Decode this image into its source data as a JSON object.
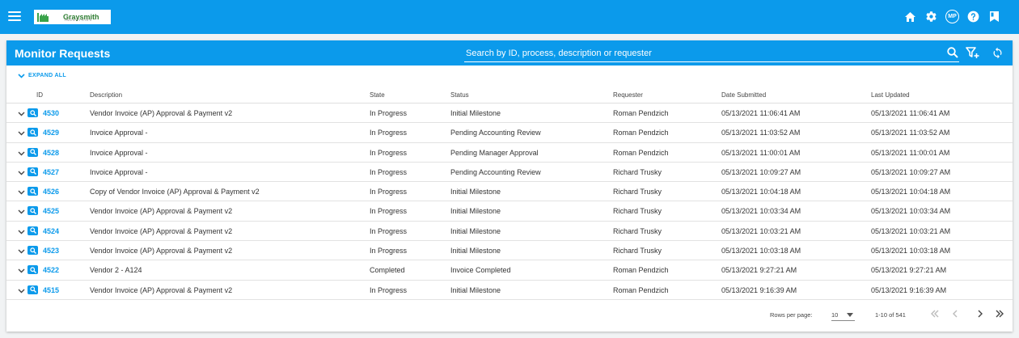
{
  "app": {
    "logo_name": "Graysmith",
    "logo_sub": "INDUSTRIES",
    "avatar_initials": "MP"
  },
  "card": {
    "title": "Monitor Requests",
    "search_placeholder": "Search by ID, process, description or requester",
    "expand_all_label": "EXPAND ALL"
  },
  "columns": {
    "id": "ID",
    "description": "Description",
    "state": "State",
    "status": "Status",
    "requester": "Requester",
    "date_submitted": "Date Submitted",
    "last_updated": "Last Updated"
  },
  "rows": [
    {
      "id": "4530",
      "description": "Vendor Invoice (AP) Approval & Payment v2",
      "state": "In Progress",
      "status": "Initial Milestone",
      "requester": "Roman Pendzich",
      "date_submitted": "05/13/2021 11:06:41 AM",
      "last_updated": "05/13/2021 11:06:41 AM"
    },
    {
      "id": "4529",
      "description": "Invoice Approval -",
      "state": "In Progress",
      "status": "Pending Accounting Review",
      "requester": "Roman Pendzich",
      "date_submitted": "05/13/2021 11:03:52 AM",
      "last_updated": "05/13/2021 11:03:52 AM"
    },
    {
      "id": "4528",
      "description": "Invoice Approval -",
      "state": "In Progress",
      "status": "Pending Manager Approval",
      "requester": "Roman Pendzich",
      "date_submitted": "05/13/2021 11:00:01 AM",
      "last_updated": "05/13/2021 11:00:01 AM"
    },
    {
      "id": "4527",
      "description": "Invoice Approval -",
      "state": "In Progress",
      "status": "Pending Accounting Review",
      "requester": "Richard Trusky",
      "date_submitted": "05/13/2021 10:09:27 AM",
      "last_updated": "05/13/2021 10:09:27 AM"
    },
    {
      "id": "4526",
      "description": "Copy of Vendor Invoice (AP) Approval & Payment v2",
      "state": "In Progress",
      "status": "Initial Milestone",
      "requester": "Richard Trusky",
      "date_submitted": "05/13/2021 10:04:18 AM",
      "last_updated": "05/13/2021 10:04:18 AM"
    },
    {
      "id": "4525",
      "description": "Vendor Invoice (AP) Approval & Payment v2",
      "state": "In Progress",
      "status": "Initial Milestone",
      "requester": "Richard Trusky",
      "date_submitted": "05/13/2021 10:03:34 AM",
      "last_updated": "05/13/2021 10:03:34 AM"
    },
    {
      "id": "4524",
      "description": "Vendor Invoice (AP) Approval & Payment v2",
      "state": "In Progress",
      "status": "Initial Milestone",
      "requester": "Richard Trusky",
      "date_submitted": "05/13/2021 10:03:21 AM",
      "last_updated": "05/13/2021 10:03:21 AM"
    },
    {
      "id": "4523",
      "description": "Vendor Invoice (AP) Approval & Payment v2",
      "state": "In Progress",
      "status": "Initial Milestone",
      "requester": "Richard Trusky",
      "date_submitted": "05/13/2021 10:03:18 AM",
      "last_updated": "05/13/2021 10:03:18 AM"
    },
    {
      "id": "4522",
      "description": "Vendor 2 - A124",
      "state": "Completed",
      "status": "Invoice Completed",
      "requester": "Roman Pendzich",
      "date_submitted": "05/13/2021 9:27:21 AM",
      "last_updated": "05/13/2021 9:27:21 AM"
    },
    {
      "id": "4515",
      "description": "Vendor Invoice (AP) Approval & Payment v2",
      "state": "In Progress",
      "status": "Initial Milestone",
      "requester": "Roman Pendzich",
      "date_submitted": "05/13/2021 9:16:39 AM",
      "last_updated": "05/13/2021 9:16:39 AM"
    }
  ],
  "pagination": {
    "rows_per_page_label": "Rows per page:",
    "rows_per_page_value": "10",
    "range_text": "1-10 of 541"
  },
  "colors": {
    "primary": "#0b9aeb"
  },
  "icons": {
    "menu": "hamburger-icon",
    "home": "home-icon",
    "settings": "gear-icon",
    "help": "help-icon",
    "bookmark": "bookmark-icon",
    "search": "search-icon",
    "filter": "filter-add-icon",
    "refresh": "refresh-icon"
  }
}
